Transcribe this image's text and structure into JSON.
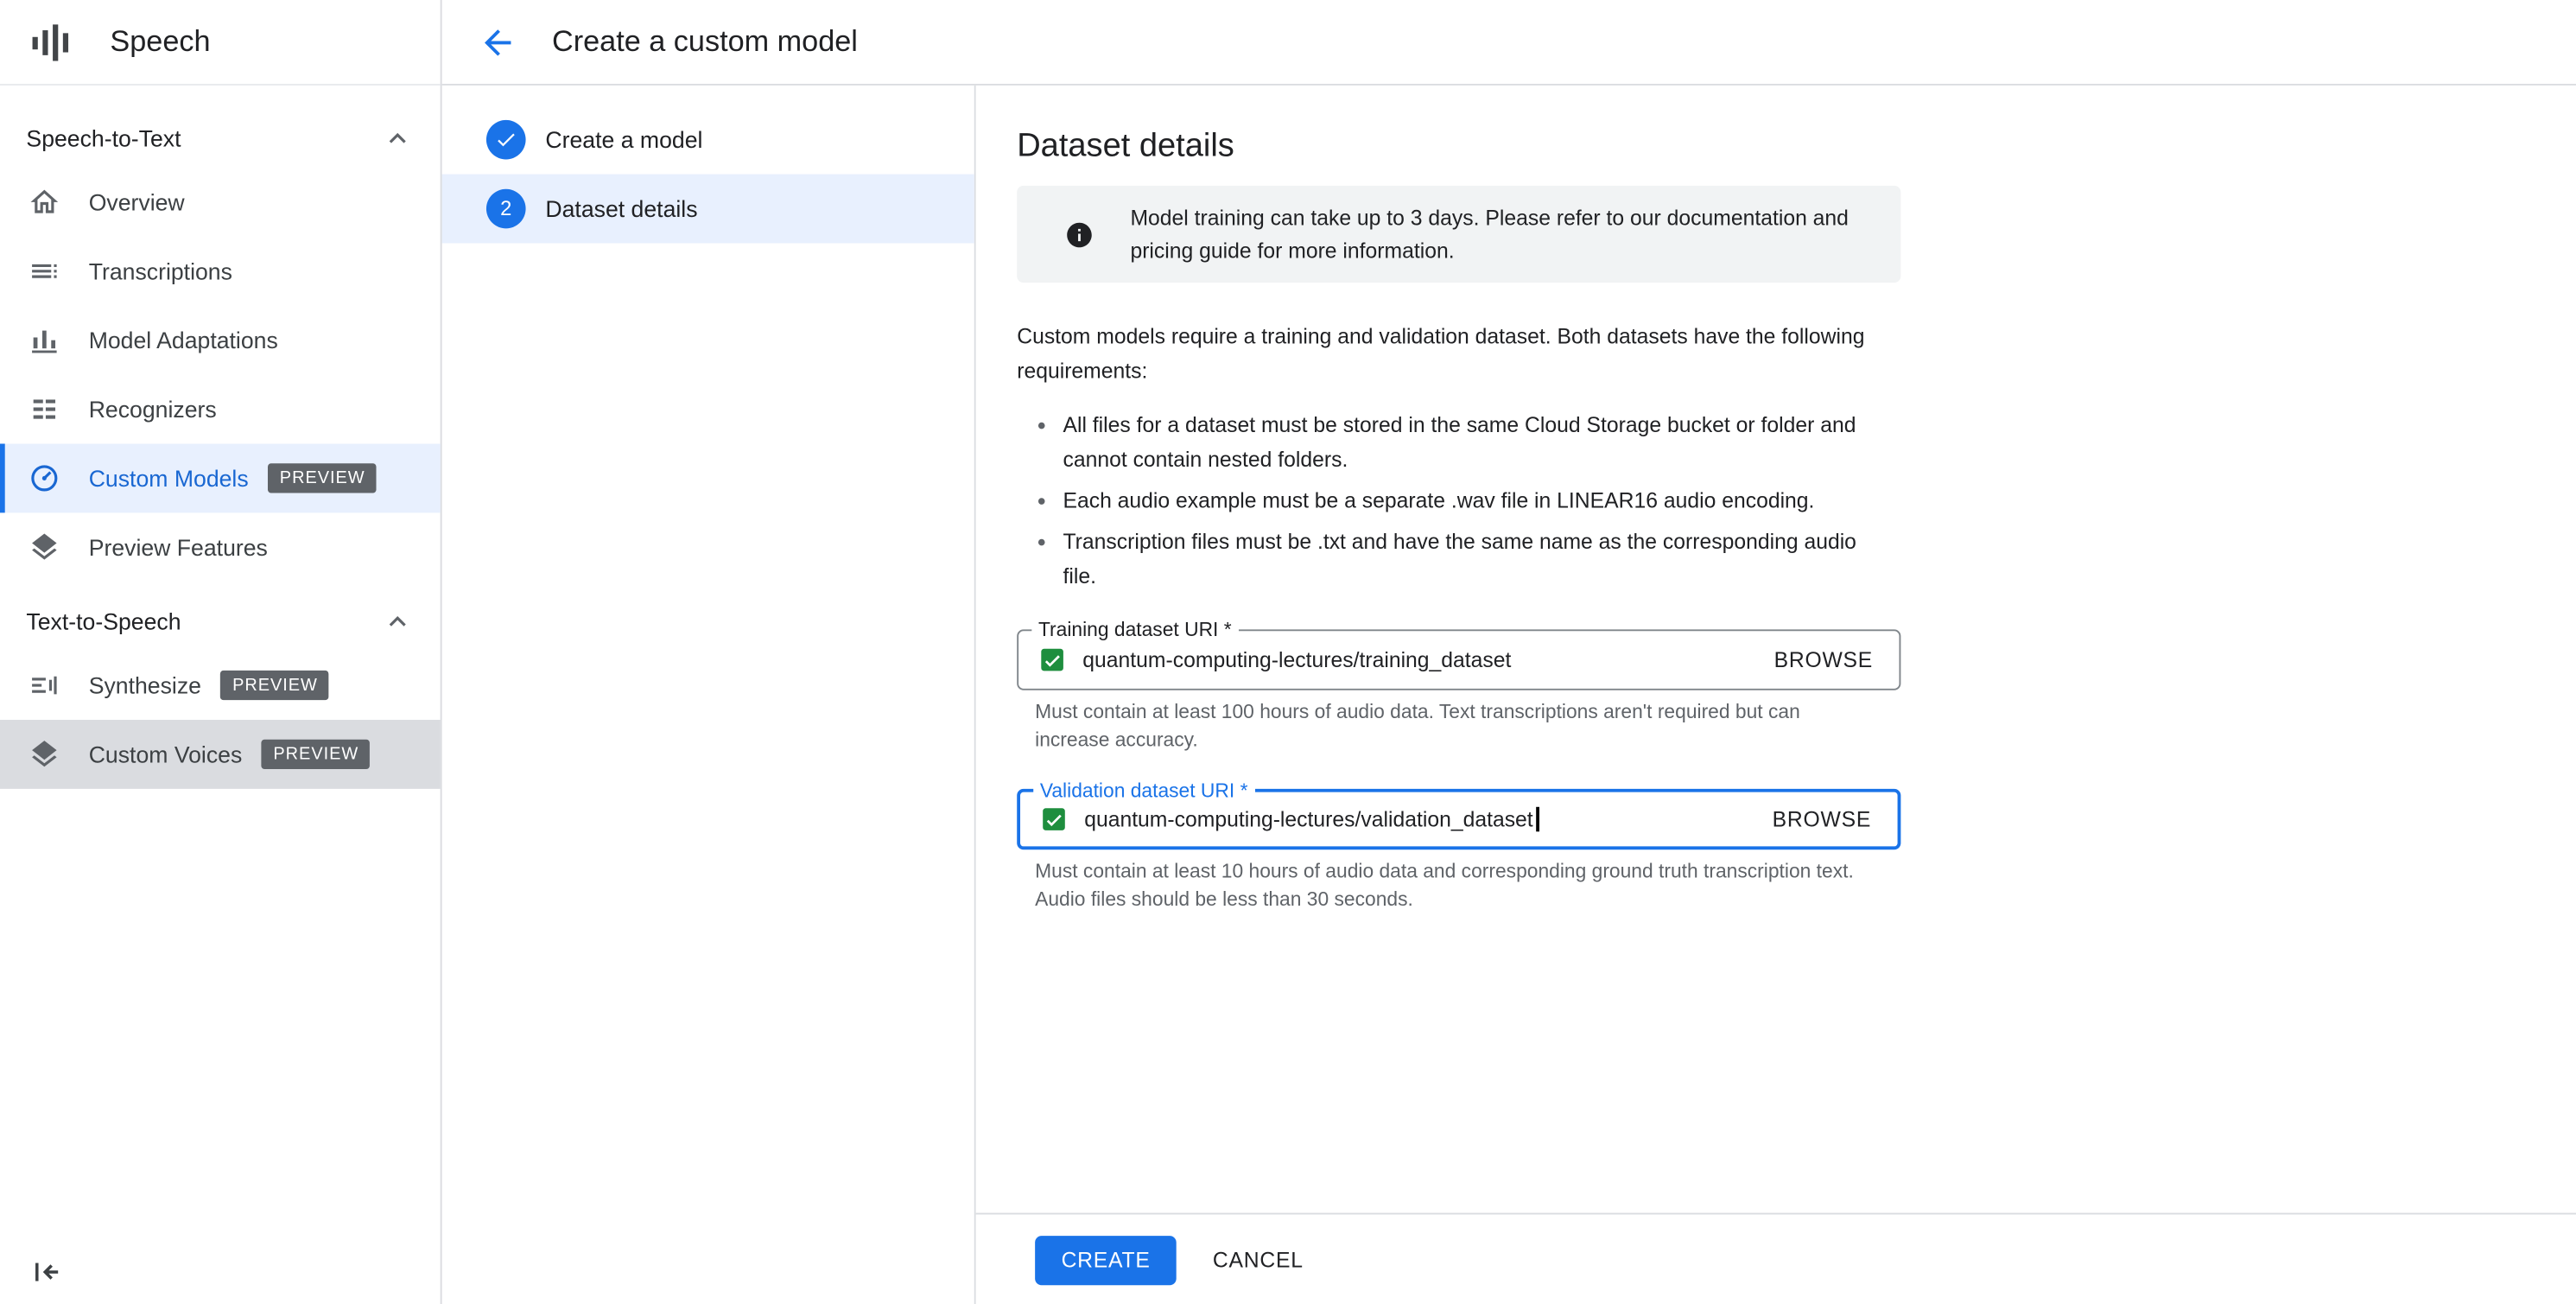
{
  "sidebar": {
    "product_name": "Speech",
    "sections": [
      {
        "label": "Speech-to-Text",
        "items": [
          {
            "label": "Overview"
          },
          {
            "label": "Transcriptions"
          },
          {
            "label": "Model Adaptations"
          },
          {
            "label": "Recognizers"
          },
          {
            "label": "Custom Models",
            "badge": "PREVIEW"
          },
          {
            "label": "Preview Features"
          }
        ]
      },
      {
        "label": "Text-to-Speech",
        "items": [
          {
            "label": "Synthesize",
            "badge": "PREVIEW"
          },
          {
            "label": "Custom Voices",
            "badge": "PREVIEW"
          }
        ]
      }
    ]
  },
  "header": {
    "title": "Create a custom model"
  },
  "stepper": {
    "steps": [
      {
        "label": "Create a model",
        "state": "complete"
      },
      {
        "label": "Dataset details",
        "number": "2",
        "state": "active"
      }
    ]
  },
  "form": {
    "title": "Dataset details",
    "banner_text": "Model training can take up to 3 days. Please refer to our documentation and pricing guide for more information.",
    "intro": "Custom models require a training and validation dataset. Both datasets have the following requirements:",
    "requirements": [
      "All files for a dataset must be stored in the same Cloud Storage bucket or folder and cannot contain nested folders.",
      "Each audio example must be a separate .wav file in LINEAR16 audio encoding.",
      "Transcription files must be .txt and have the same name as the corresponding audio file."
    ],
    "training": {
      "label": "Training dataset URI *",
      "value": "quantum-computing-lectures/training_dataset",
      "browse_label": "BROWSE",
      "helper": "Must contain at least 100 hours of audio data. Text transcriptions aren't required but can increase accuracy."
    },
    "validation": {
      "label": "Validation dataset URI *",
      "value": "quantum-computing-lectures/validation_dataset",
      "browse_label": "BROWSE",
      "helper": "Must contain at least 10 hours of audio data and corresponding ground truth transcription text. Audio files should be less than 30 seconds."
    },
    "actions": {
      "create": "CREATE",
      "cancel": "CANCEL"
    }
  },
  "colors": {
    "primary_blue": "#1a73e8",
    "active_item_blue": "#1967d2",
    "active_item_bg": "#e8f0fe",
    "selected_gray_bg": "#dadce0",
    "banner_bg": "#f1f3f4",
    "badge_bg": "#5f6368",
    "storage_green": "#1e8e3e",
    "text_primary": "#202124",
    "text_secondary": "#5f6368",
    "border": "#dadce0"
  }
}
